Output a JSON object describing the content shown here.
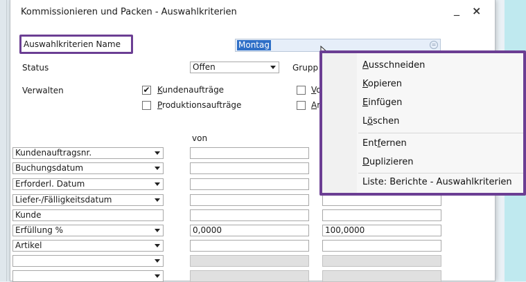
{
  "window": {
    "title": "Kommissionieren und Packen - Auswahlkriterien",
    "minimize_glyph": "_",
    "close_glyph": "×"
  },
  "form": {
    "name_label": "Auswahlkriterien Name",
    "name_value": "Montag",
    "status_label": "Status",
    "status_value": "Offen",
    "gruppe_label": "Grupp",
    "verwalten_label": "Verwalten",
    "von_label": "von"
  },
  "checkboxes": [
    {
      "label": "Kundenaufträge",
      "accel": "K",
      "rest": "undenaufträge",
      "checked": true
    },
    {
      "label": "Produktionsaufträge",
      "accel": "P",
      "rest": "roduktionsaufträge",
      "checked": false
    },
    {
      "label": "Vo",
      "accel": "V",
      "rest": "o",
      "checked": false
    },
    {
      "label": "Ar",
      "accel": "A",
      "rest": "r",
      "checked": false
    }
  ],
  "criteria_rows": [
    {
      "field": "Kundenauftragsnr.",
      "von": "",
      "bis": ""
    },
    {
      "field": "Buchungsdatum",
      "von": "",
      "bis": ""
    },
    {
      "field": "Erforderl. Datum",
      "von": "",
      "bis": ""
    },
    {
      "field": "Liefer-/Fälligkeitsdatum",
      "von": "",
      "bis": ""
    },
    {
      "field": "Kunde",
      "von": "",
      "bis": ""
    },
    {
      "field": "Erfüllung %",
      "von": "0,0000",
      "bis": "100,0000"
    },
    {
      "field": "Artikel",
      "von": "",
      "bis": ""
    },
    {
      "field": "",
      "von": "",
      "bis": ""
    },
    {
      "field": "",
      "von": "",
      "bis": ""
    }
  ],
  "context_menu": [
    {
      "label": "Ausschneiden",
      "before": "",
      "accel": "A",
      "after": "usschneiden"
    },
    {
      "label": "Kopieren",
      "before": "",
      "accel": "K",
      "after": "opieren"
    },
    {
      "label": "Einfügen",
      "before": "",
      "accel": "E",
      "after": "infügen"
    },
    {
      "label": "Löschen",
      "before": "L",
      "accel": "ö",
      "after": "schen"
    },
    {
      "label": "Entfernen",
      "before": "Ent",
      "accel": "f",
      "after": "ernen"
    },
    {
      "label": "Duplizieren",
      "before": "",
      "accel": "D",
      "after": "uplizieren"
    },
    {
      "label": "Liste: Berichte - Auswahlkriterien",
      "before": "Liste: Berichte - Auswahlkriterien",
      "accel": "",
      "after": ""
    }
  ],
  "colors": {
    "highlight": "#6b3e93",
    "selection": "#2e6fc7"
  }
}
